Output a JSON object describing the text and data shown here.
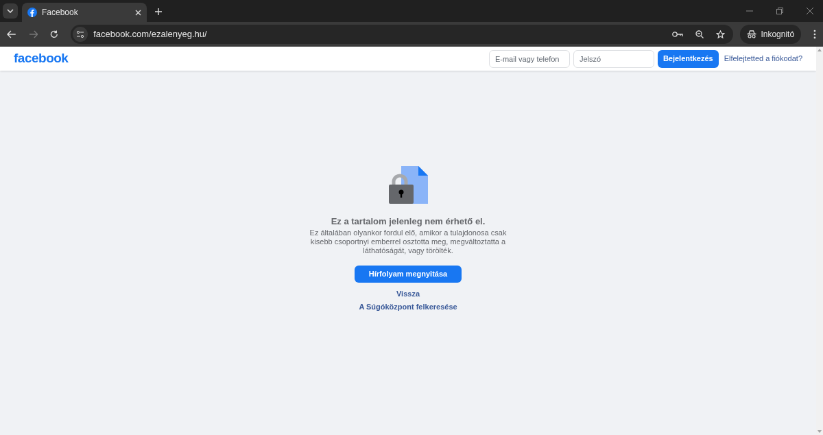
{
  "browser": {
    "tab": {
      "title": "Facebook",
      "selected": true
    },
    "url": "facebook.com/ezalenyeg.hu/",
    "profile_label": "Inkognitó"
  },
  "header": {
    "logo": "facebook",
    "email_field": {
      "placeholder": "E-mail vagy telefon"
    },
    "password_field": {
      "placeholder": "Jelszó"
    },
    "login_button": "Bejelentkezés",
    "forgot_link": "Elfelejtetted a fiókodat?"
  },
  "message": {
    "title": "Ez a tartalom jelenleg nem érhető el.",
    "body": "Ez általában olyankor fordul elő, amikor a tulajdonosa csak kisebb csoportnyi emberrel osztotta meg, megváltoztatta a láthatóságát, vagy törölték.",
    "primary_button": "Hírfolyam megnyitása",
    "links": [
      "Vissza",
      "A Súgóközpont felkeresése"
    ]
  }
}
